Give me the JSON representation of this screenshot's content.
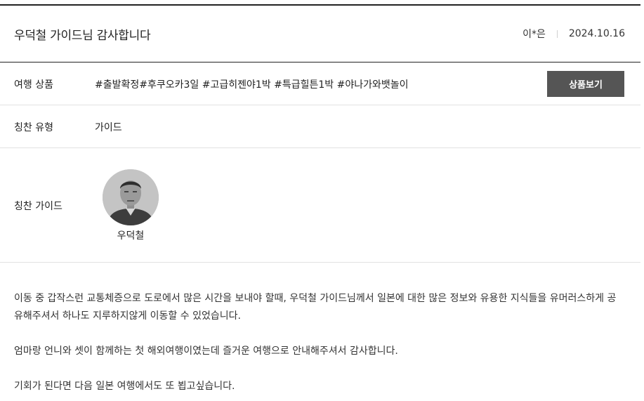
{
  "review": {
    "title": "우덕철 가이드님 감사합니다",
    "author": "이*은",
    "date": "2024.10.16"
  },
  "product": {
    "label": "여행 상품",
    "value": "#출발확정#후쿠오카3일 #고급히젠야1박 #특급힐튼1박 #야나가와뱃놀이",
    "button_label": "상품보기"
  },
  "praise_type": {
    "label": "칭찬 유형",
    "value": "가이드"
  },
  "praise_guide": {
    "label": "칭찬 가이드",
    "name": "우덕철",
    "photo_icon": "guide-portrait"
  },
  "content": {
    "paragraph_1": "이동 중 갑작스런 교통체증으로 도로에서 많은 시간을 보내야 할때, 우덕철 가이드님께서 일본에 대한 많은 정보와 유용한 지식들을 유머러스하게 공유해주셔서 하나도 지루하지않게 이동할 수 있었습니다.",
    "paragraph_2": "엄마랑 언니와 셋이 함께하는 첫 해외여행이였는데 즐거운 여행으로 안내해주셔서 감사합니다.",
    "paragraph_3": "기회가 된다면 다음 일본 여행에서도 또 뵙고싶습니다."
  }
}
